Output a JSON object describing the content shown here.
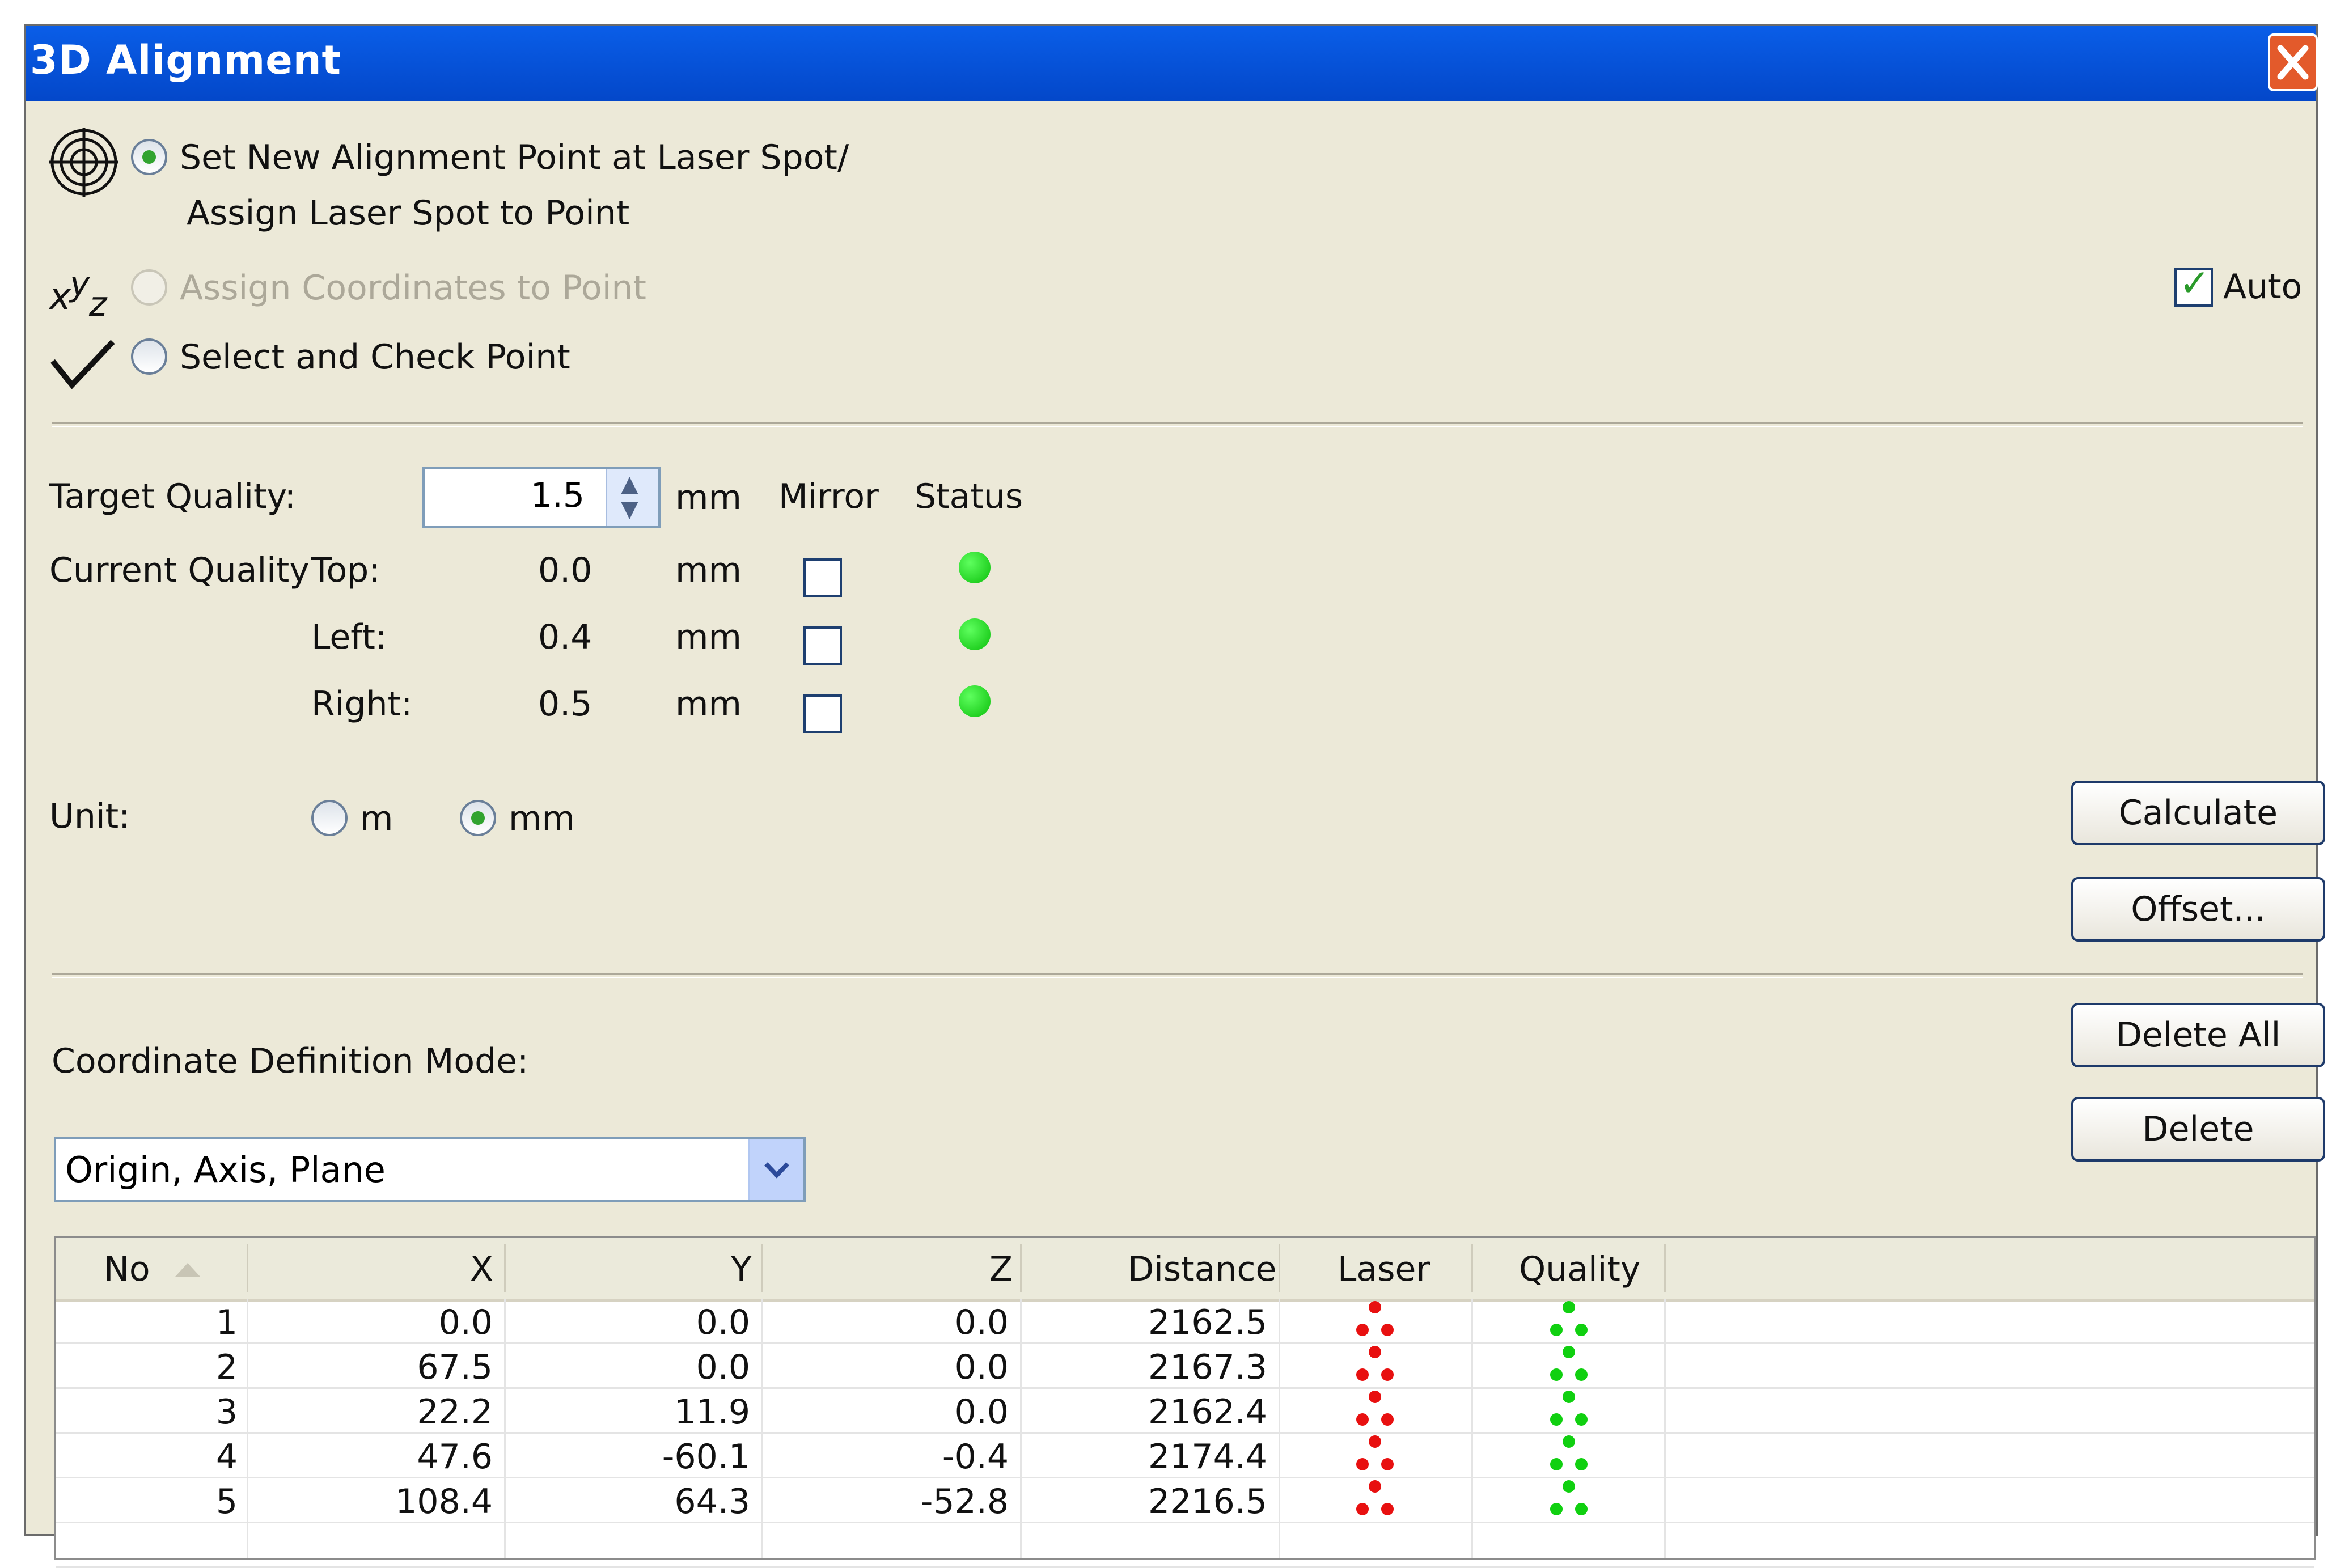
{
  "window": {
    "title": "3D Alignment"
  },
  "modes": {
    "set_new_line1": "Set New Alignment Point at Laser Spot/",
    "set_new_line2": "Assign Laser Spot to Point",
    "assign_coords": "Assign Coordinates to Point",
    "select_check": "Select and Check Point",
    "selected": "set_new"
  },
  "auto": {
    "label": "Auto",
    "checked": true
  },
  "quality": {
    "target_label": "Target Quality:",
    "target_value": "1.5",
    "unit": "mm",
    "mirror_header": "Mirror",
    "status_header": "Status",
    "current_label": "Current Quality",
    "rows": [
      {
        "label": "Top:",
        "value": "0.0",
        "unit": "mm",
        "mirror": false,
        "status": "green"
      },
      {
        "label": "Left:",
        "value": "0.4",
        "unit": "mm",
        "mirror": false,
        "status": "green"
      },
      {
        "label": "Right:",
        "value": "0.5",
        "unit": "mm",
        "mirror": false,
        "status": "green"
      }
    ]
  },
  "unit": {
    "label": "Unit:",
    "options": [
      "m",
      "mm"
    ],
    "selected": "mm"
  },
  "buttons": {
    "calculate": "Calculate",
    "offset": "Offset...",
    "delete_all": "Delete All",
    "delete": "Delete"
  },
  "coord_mode": {
    "label": "Coordinate Definition Mode:",
    "value": "Origin, Axis, Plane"
  },
  "table": {
    "headers": [
      "No",
      "X",
      "Y",
      "Z",
      "Distance",
      "Laser",
      "Quality"
    ],
    "rows": [
      [
        "1",
        "0.0",
        "0.0",
        "0.0",
        "2162.5"
      ],
      [
        "2",
        "67.5",
        "0.0",
        "0.0",
        "2167.3"
      ],
      [
        "3",
        "22.2",
        "11.9",
        "0.0",
        "2162.4"
      ],
      [
        "4",
        "47.6",
        "-60.1",
        "-0.4",
        "2174.4"
      ],
      [
        "5",
        "108.4",
        "64.3",
        "-52.8",
        "2216.5"
      ]
    ],
    "laser_color": "#e81010",
    "quality_color": "#10d010"
  }
}
